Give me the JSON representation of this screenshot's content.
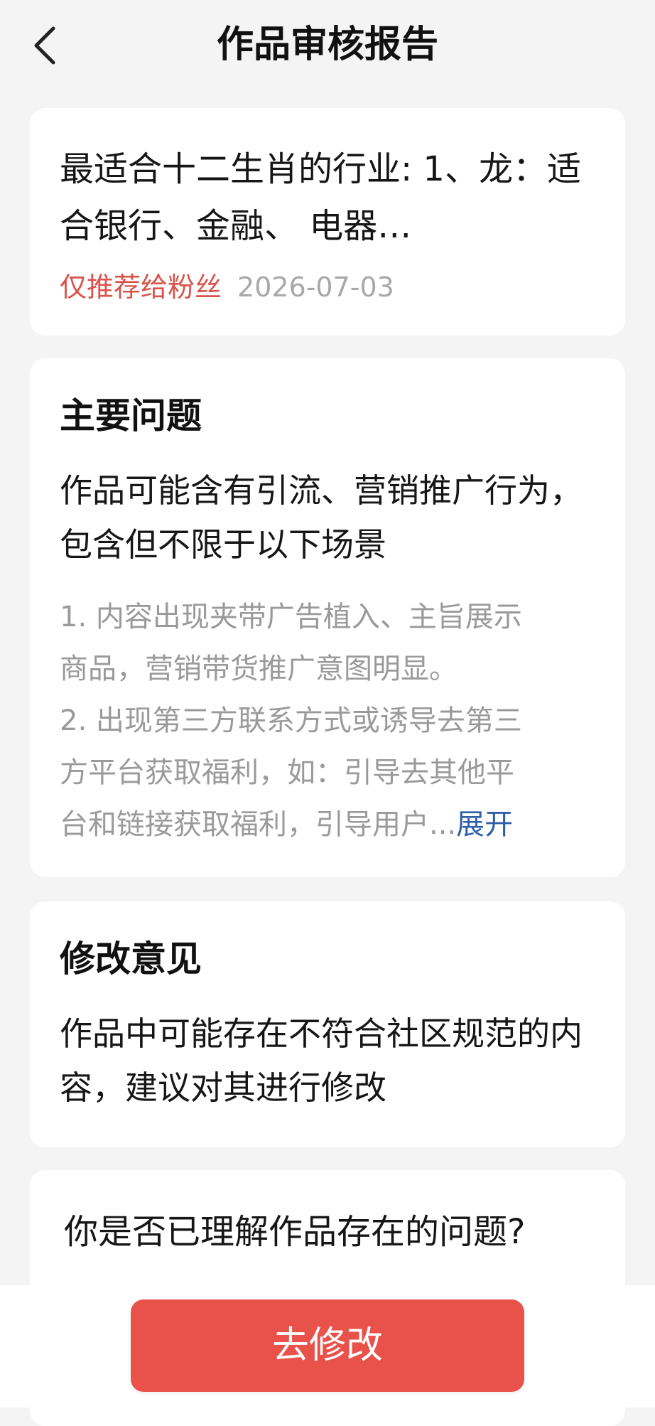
{
  "header": {
    "back_icon": "chevron-left-icon",
    "title": "作品审核报告"
  },
  "work": {
    "title": "最适合十二生肖的行业: 1、龙：适合银行、金融、 电器…",
    "tag": "仅推荐给粉丝",
    "date": "2026-07-03"
  },
  "main_issue": {
    "heading": "主要问题",
    "summary": "作品可能含有引流、营销推广行为，包含但不限于以下场景",
    "details": [
      "1. 内容出现夹带广告植入、主旨展示",
      "商品，营销带货推广意图明显。",
      "2. 出现第三方联系方式或诱导去第三",
      "方平台获取福利，如：引导去其他平",
      "台和链接获取福利，引导用户..."
    ],
    "expand_label": "展开"
  },
  "suggestion": {
    "heading": "修改意见",
    "body": "作品中可能存在不符合社区规范的内容，建议对其进行修改"
  },
  "question": {
    "text": "你是否已理解作品存在的问题?"
  },
  "action": {
    "button_label": "去修改"
  },
  "colors": {
    "accent": "#e9524a",
    "tag_red": "#d9534a",
    "link_blue": "#2f5ea8",
    "muted_gray": "#9a9a9a",
    "background": "#f4f4f4"
  }
}
